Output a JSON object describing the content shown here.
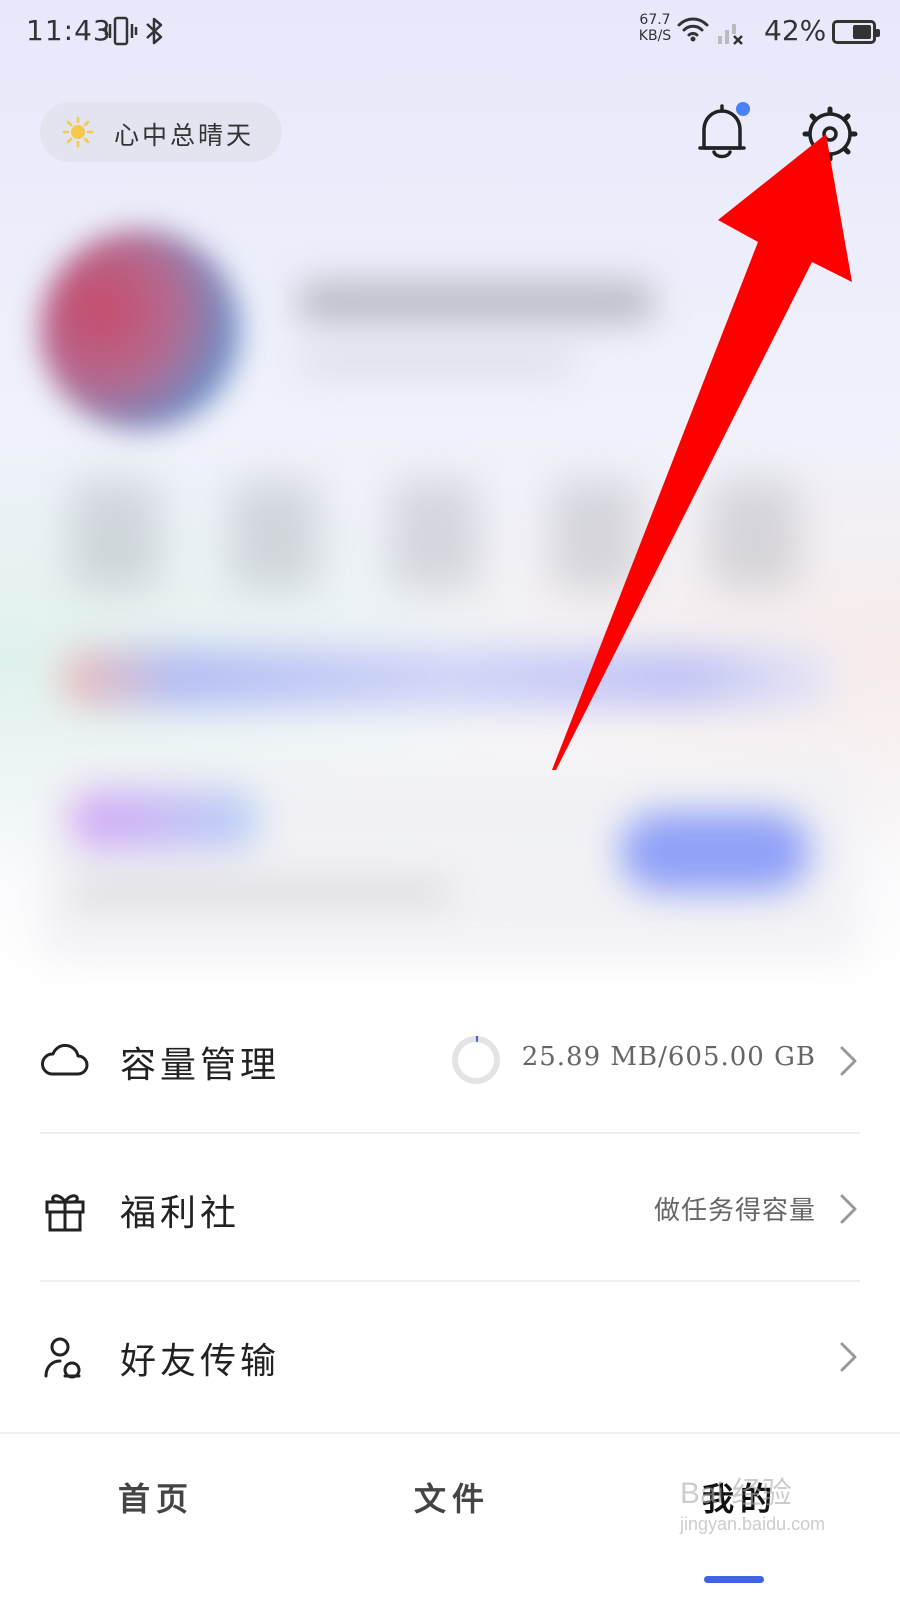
{
  "status_bar": {
    "time": "11:43",
    "net_speed_value": "67.7",
    "net_speed_unit": "KB/S",
    "battery_percent": "42%"
  },
  "header": {
    "weather_text": "心中总晴天",
    "weather_icon": "sun-icon",
    "notification_icon": "bell-icon",
    "settings_icon": "gear-icon",
    "notification_dot_color": "#4a7ff7"
  },
  "menu": {
    "items": [
      {
        "icon": "cloud-icon",
        "label": "容量管理",
        "value": "25.89  MB/605.00  GB"
      },
      {
        "icon": "gift-icon",
        "label": "福利社",
        "value": "做任务得容量"
      },
      {
        "icon": "users-icon",
        "label": "好友传输",
        "value": ""
      }
    ]
  },
  "bottom_nav": {
    "tabs": [
      "首页",
      "文件",
      "我的"
    ],
    "active_tab": 2,
    "accent_color": "#3f62e6"
  },
  "watermark": {
    "text": "Bai 经验",
    "sub": "jingyan.baidu.com"
  },
  "annotation": {
    "arrow_color": "#ff0000"
  }
}
